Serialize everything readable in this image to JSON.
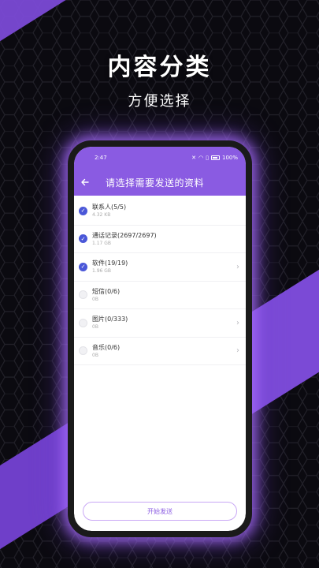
{
  "promo": {
    "headline": "内容分类",
    "subline": "方便选择"
  },
  "statusbar": {
    "time": "2:47",
    "battery": "100%"
  },
  "appbar": {
    "back_icon": "arrow-left-icon",
    "title": "请选择需要发送的资料"
  },
  "items": [
    {
      "label": "联系人(5/5)",
      "size": "4.32 KB",
      "checked": true,
      "has_arrow": false
    },
    {
      "label": "通话记录(2697/2697)",
      "size": "1.17 GB",
      "checked": true,
      "has_arrow": false
    },
    {
      "label": "软件(19/19)",
      "size": "1.96 GB",
      "checked": true,
      "has_arrow": true
    },
    {
      "label": "短信(0/6)",
      "size": "0B",
      "checked": false,
      "has_arrow": false
    },
    {
      "label": "图片(0/333)",
      "size": "0B",
      "checked": false,
      "has_arrow": true
    },
    {
      "label": "音乐(0/6)",
      "size": "0B",
      "checked": false,
      "has_arrow": true
    }
  ],
  "start_button": {
    "label": "开始发送"
  },
  "colors": {
    "accent": "#8a5be2",
    "check": "#4a57d8",
    "background": "#0b0a10"
  }
}
